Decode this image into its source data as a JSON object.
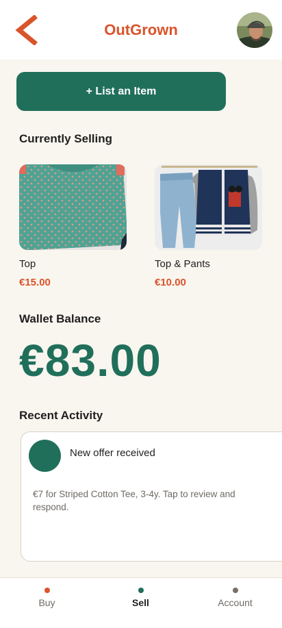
{
  "header": {
    "title": "OutGrown",
    "back_icon": "chevron-left-icon",
    "avatar_icon": "user-avatar"
  },
  "actions": {
    "list_item_label": "+  List an Item"
  },
  "selling": {
    "heading": "Currently Selling",
    "items": [
      {
        "name": "Top",
        "price": "€15.00"
      },
      {
        "name": "Top & Pants",
        "price": "€10.00"
      }
    ]
  },
  "wallet": {
    "heading": "Wallet Balance",
    "amount": "€83.00"
  },
  "activity": {
    "heading": "Recent Activity",
    "items": [
      {
        "title": "New offer received",
        "body": "€7 for Striped Cotton Tee, 3-4y. Tap to review and respond."
      }
    ]
  },
  "nav": {
    "items": [
      {
        "label": "Buy",
        "dot_color": "#d9542b",
        "active": false
      },
      {
        "label": "Sell",
        "dot_color": "#206f5b",
        "active": true
      },
      {
        "label": "Account",
        "dot_color": "#7a6d62",
        "active": false
      }
    ]
  },
  "colors": {
    "brand": "#d9542b",
    "primary": "#206f5b",
    "background": "#f9f5ef"
  }
}
